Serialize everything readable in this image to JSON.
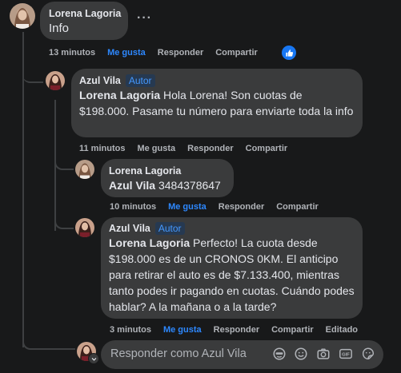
{
  "comments": [
    {
      "author": "Lorena Lagoria",
      "text": "Info",
      "actions": {
        "time": "13 minutos",
        "like": "Me gusta",
        "reply": "Responder",
        "share": "Compartir"
      },
      "more": "···"
    },
    {
      "author": "Azul Vila",
      "badge": "Autor",
      "mention": "Lorena Lagoria",
      "text": " Hola Lorena! Son cuotas de $198.000. Pasame tu número para enviarte toda la info",
      "actions": {
        "time": "11 minutos",
        "like": "Me gusta",
        "reply": "Responder",
        "share": "Compartir"
      }
    },
    {
      "author": "Lorena Lagoria",
      "mention": "Azul Vila",
      "text": " 3484378647",
      "actions": {
        "time": "10 minutos",
        "like": "Me gusta",
        "reply": "Responder",
        "share": "Compartir"
      }
    },
    {
      "author": "Azul Vila",
      "badge": "Autor",
      "mention": "Lorena Lagoria",
      "text": " Perfecto! La cuota desde $198.000 es de un CRONOS 0KM. El anticipo para retirar el auto es de $7.133.400, mientras tanto podes ir pagando en cuotas. Cuándo podes hablar? A la mañana o a la tarde?",
      "actions": {
        "time": "3 minutos",
        "like": "Me gusta",
        "reply": "Responder",
        "share": "Compartir",
        "edited": "Editado"
      }
    }
  ],
  "reply_box": {
    "placeholder": "Responder como Azul Vila",
    "tools": [
      "avatar-sticker-icon",
      "emoji-icon",
      "camera-icon",
      "gif-icon",
      "sticker-icon"
    ]
  },
  "colors": {
    "background": "#18191a",
    "bubble": "#3a3b3c",
    "text": "#e4e6eb",
    "secondary": "#b0b3b8",
    "accent": "#2d88ff"
  }
}
